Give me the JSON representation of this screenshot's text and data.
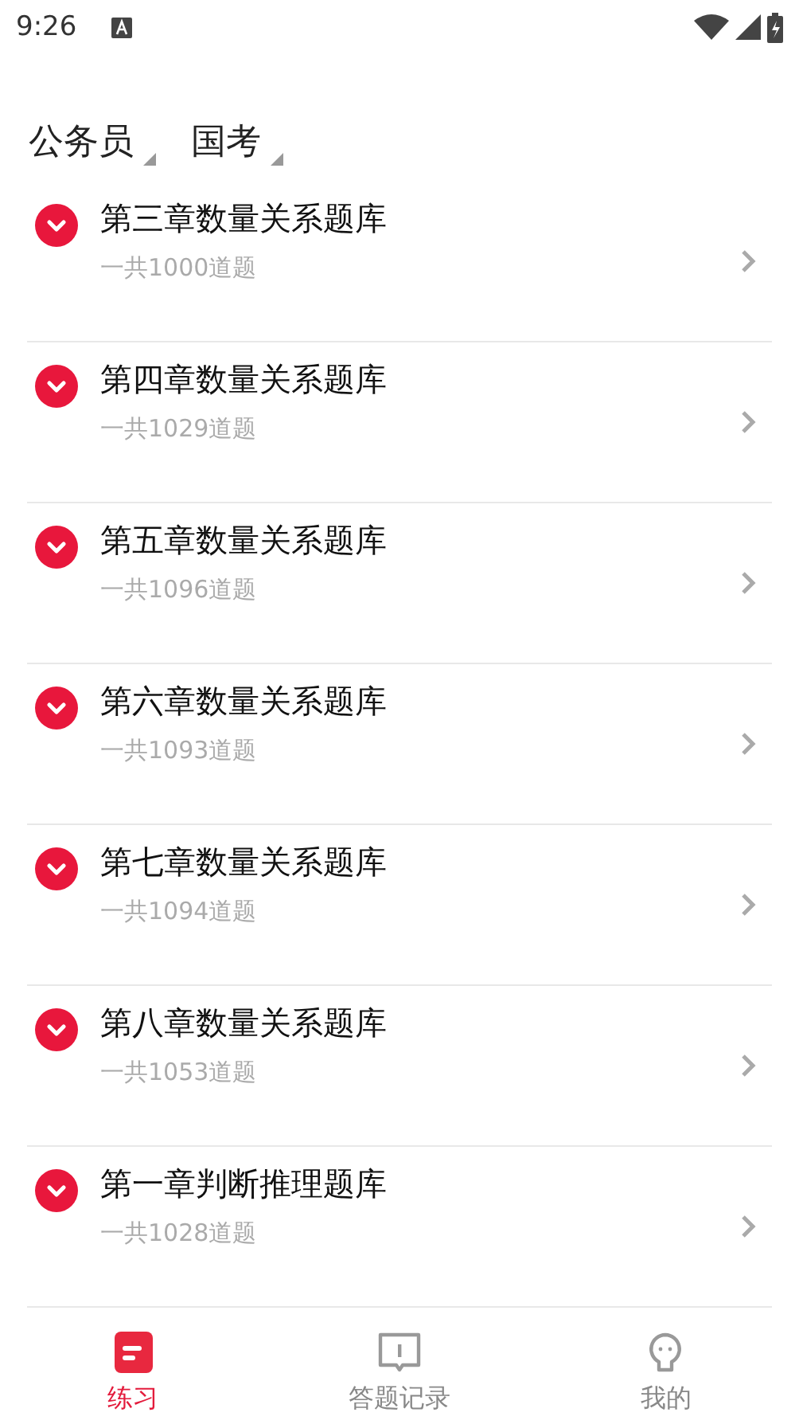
{
  "status_bar": {
    "time": "9:26"
  },
  "filters": [
    {
      "label": "公务员"
    },
    {
      "label": "国考"
    }
  ],
  "banks": [
    {
      "title": "第三章数量关系题库",
      "count": "一共1000道题"
    },
    {
      "title": "第四章数量关系题库",
      "count": "一共1029道题"
    },
    {
      "title": "第五章数量关系题库",
      "count": "一共1096道题"
    },
    {
      "title": "第六章数量关系题库",
      "count": "一共1093道题"
    },
    {
      "title": "第七章数量关系题库",
      "count": "一共1094道题"
    },
    {
      "title": "第八章数量关系题库",
      "count": "一共1053道题"
    },
    {
      "title": "第一章判断推理题库",
      "count": "一共1028道题"
    }
  ],
  "nav": [
    {
      "kind": "practice",
      "label": "练习",
      "selected": true
    },
    {
      "kind": "record",
      "label": "答题记录",
      "selected": false
    },
    {
      "kind": "mine",
      "label": "我的",
      "selected": false
    }
  ]
}
